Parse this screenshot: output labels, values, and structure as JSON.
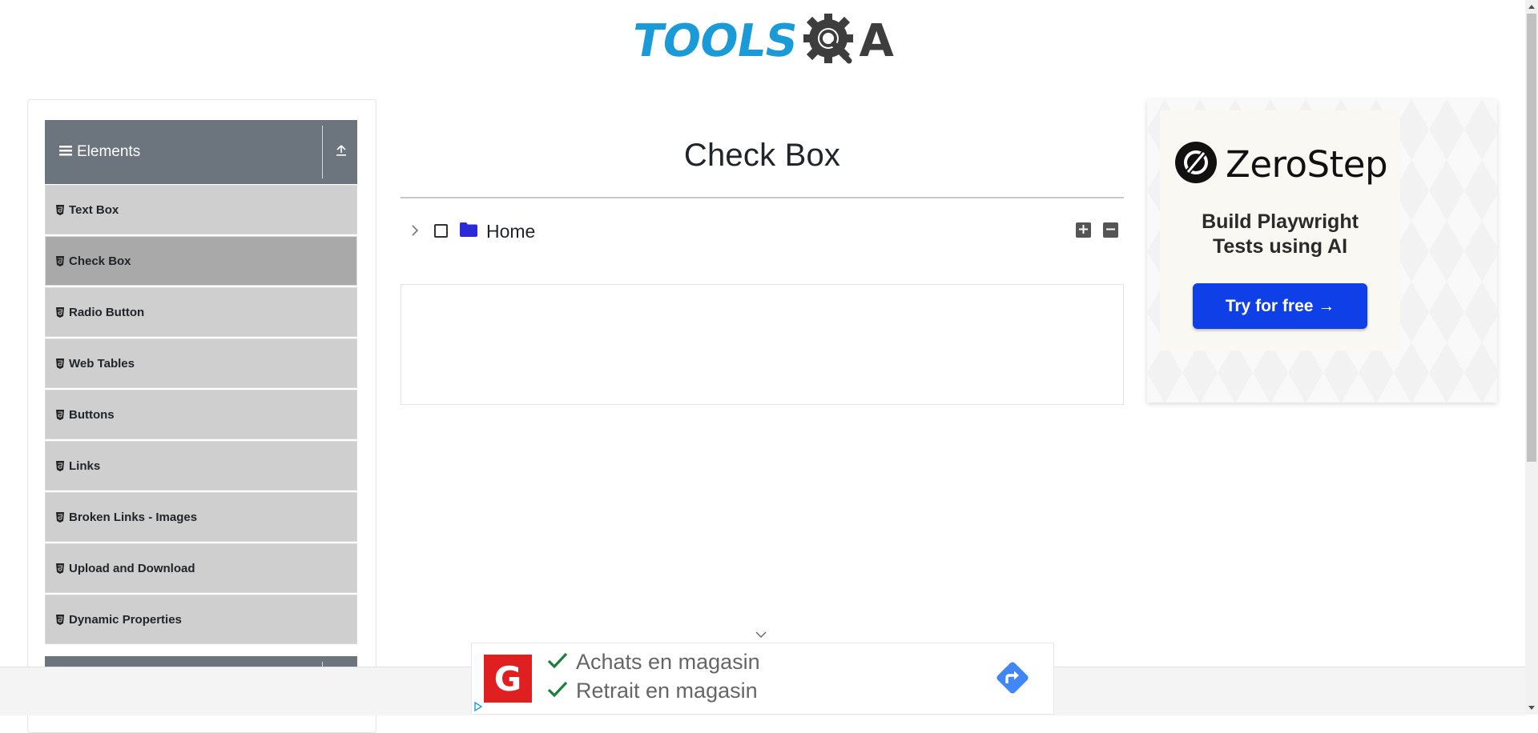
{
  "header": {
    "logo_tools": "TOOLS",
    "logo_qa": "A"
  },
  "sidebar": {
    "group_title": "Elements",
    "items": [
      {
        "label": "Text Box",
        "active": false
      },
      {
        "label": "Check Box",
        "active": true
      },
      {
        "label": "Radio Button",
        "active": false
      },
      {
        "label": "Web Tables",
        "active": false
      },
      {
        "label": "Buttons",
        "active": false
      },
      {
        "label": "Links",
        "active": false
      },
      {
        "label": "Broken Links - Images",
        "active": false
      },
      {
        "label": "Upload and Download",
        "active": false
      },
      {
        "label": "Dynamic Properties",
        "active": false
      }
    ]
  },
  "main": {
    "title": "Check Box",
    "tree": {
      "root_label": "Home",
      "checked": false,
      "expanded": false
    }
  },
  "right_ad": {
    "brand": "ZeroStep",
    "tagline_line1": "Build Playwright",
    "tagline_line2": "Tests using AI",
    "cta": "Try for free →"
  },
  "bottom_ad": {
    "logo_letter": "G",
    "line1": "Achats en magasin",
    "line2": "Retrait en magasin"
  },
  "colors": {
    "tools_blue": "#1a9bd7",
    "sidebar_header": "#6c757d",
    "menu_item": "#cfcfcf",
    "menu_item_active": "#a9a9a9",
    "folder": "#2a2ad6",
    "cta_blue": "#0f3fe6",
    "ad_red": "#e02020",
    "check_green": "#188038",
    "directions_blue": "#4285f4"
  }
}
